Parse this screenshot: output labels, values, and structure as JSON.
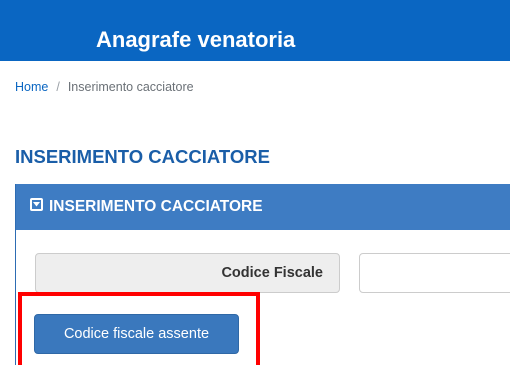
{
  "app": {
    "title": "Anagrafe venatoria"
  },
  "breadcrumb": {
    "home": "Home",
    "separator": "/",
    "current": "Inserimento cacciatore"
  },
  "page": {
    "title": "INSERIMENTO CACCIATORE"
  },
  "panel": {
    "title": "INSERIMENTO CACCIATORE",
    "icon": "collapse-square-icon"
  },
  "form": {
    "codice_fiscale_label": "Codice Fiscale",
    "codice_fiscale_value": "",
    "missing_button_label": "Codice fiscale assente"
  },
  "colors": {
    "header_bg": "#0a66c2",
    "panel_header_bg": "#3e7cc3",
    "title_text": "#1a5ea8",
    "button_bg": "#3a78bd",
    "highlight": "#ff0000"
  }
}
